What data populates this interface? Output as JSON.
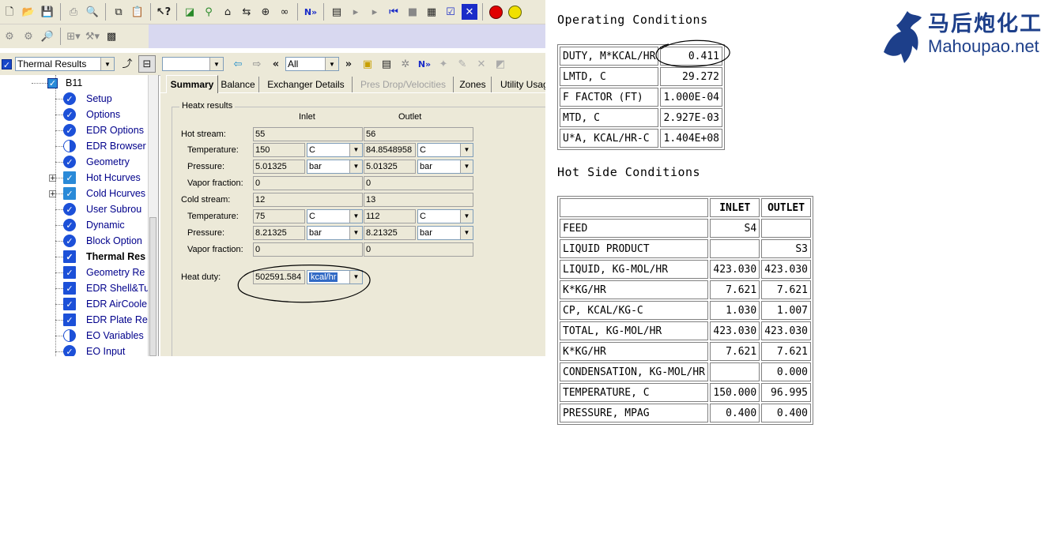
{
  "toolbar3": {
    "results_combo": "Thermal Results",
    "nav_combo": "All",
    "blank_combo": ""
  },
  "tree": {
    "root": "B11",
    "items": [
      {
        "label": "Setup",
        "icon": "check-circle-icon"
      },
      {
        "label": "Options",
        "icon": "check-circle-icon"
      },
      {
        "label": "EDR Options",
        "icon": "check-circle-icon"
      },
      {
        "label": "EDR Browser",
        "icon": "half-circle-icon"
      },
      {
        "label": "Geometry",
        "icon": "check-circle-icon"
      },
      {
        "label": "Hot Hcurves",
        "icon": "check-folder-icon"
      },
      {
        "label": "Cold Hcurves",
        "icon": "check-folder-icon"
      },
      {
        "label": "User Subrou",
        "icon": "check-circle-icon"
      },
      {
        "label": "Dynamic",
        "icon": "check-circle-icon"
      },
      {
        "label": "Block Option",
        "icon": "check-circle-icon"
      },
      {
        "label": "Thermal Res",
        "icon": "check-box-icon"
      },
      {
        "label": "Geometry Re",
        "icon": "check-box-icon"
      },
      {
        "label": "EDR Shell&Tu",
        "icon": "check-box-icon"
      },
      {
        "label": "EDR AirCoole",
        "icon": "check-box-icon"
      },
      {
        "label": "EDR Plate Re",
        "icon": "check-box-icon"
      },
      {
        "label": "EO Variables",
        "icon": "half-circle-icon"
      },
      {
        "label": "EO Input",
        "icon": "check-circle-icon"
      }
    ]
  },
  "tabs": [
    "Summary",
    "Balance",
    "Exchanger Details",
    "Pres Drop/Velocities",
    "Zones",
    "Utility Usage"
  ],
  "heatx": {
    "group_title": "Heatx results",
    "inlet_label": "Inlet",
    "outlet_label": "Outlet",
    "hot_stream_label": "Hot stream:",
    "hot_stream_inlet": "55",
    "hot_stream_outlet": "56",
    "temperature_label": "Temperature:",
    "hot_temp_inlet": "150",
    "hot_temp_inlet_unit": "C",
    "hot_temp_outlet": "84.8548958",
    "hot_temp_outlet_unit": "C",
    "pressure_label": "Pressure:",
    "hot_pres_inlet": "5.01325",
    "hot_pres_inlet_unit": "bar",
    "hot_pres_outlet": "5.01325",
    "hot_pres_outlet_unit": "bar",
    "vapor_label": "Vapor fraction:",
    "hot_vap_inlet": "0",
    "hot_vap_outlet": "0",
    "cold_stream_label": "Cold stream:",
    "cold_stream_inlet": "12",
    "cold_stream_outlet": "13",
    "cold_temp_inlet": "75",
    "cold_temp_inlet_unit": "C",
    "cold_temp_outlet": "112",
    "cold_temp_outlet_unit": "C",
    "cold_pres_inlet": "8.21325",
    "cold_pres_inlet_unit": "bar",
    "cold_pres_outlet": "8.21325",
    "cold_pres_outlet_unit": "bar",
    "cold_vap_inlet": "0",
    "cold_vap_outlet": "0",
    "heat_duty_label": "Heat duty:",
    "heat_duty_value": "502591.584",
    "heat_duty_unit": "kcal/hr"
  },
  "report": {
    "operating_title": "Operating Conditions",
    "operating_rows": [
      {
        "label": "DUTY, M*KCAL/HR",
        "value": "0.411"
      },
      {
        "label": "LMTD, C",
        "value": "29.272"
      },
      {
        "label": "F FACTOR (FT)",
        "value": "1.000E-04"
      },
      {
        "label": "MTD, C",
        "value": "2.927E-03"
      },
      {
        "label": "U*A, KCAL/HR-C",
        "value": "1.404E+08"
      }
    ],
    "hot_side_title": "Hot Side Conditions",
    "hot_side_headers": [
      "",
      "INLET",
      "OUTLET"
    ],
    "hot_side_rows": [
      {
        "label": "FEED",
        "inlet": "S4",
        "outlet": ""
      },
      {
        "label": "LIQUID PRODUCT",
        "inlet": "",
        "outlet": "S3"
      },
      {
        "label": "LIQUID, KG-MOL/HR",
        "inlet": "423.030",
        "outlet": "423.030"
      },
      {
        "label": "K*KG/HR",
        "inlet": "7.621",
        "outlet": "7.621"
      },
      {
        "label": "CP, KCAL/KG-C",
        "inlet": "1.030",
        "outlet": "1.007"
      },
      {
        "label": "TOTAL, KG-MOL/HR",
        "inlet": "423.030",
        "outlet": "423.030"
      },
      {
        "label": "K*KG/HR",
        "inlet": "7.621",
        "outlet": "7.621"
      },
      {
        "label": "CONDENSATION, KG-MOL/HR",
        "inlet": "",
        "outlet": "0.000"
      },
      {
        "label": "TEMPERATURE, C",
        "inlet": "150.000",
        "outlet": "96.995"
      },
      {
        "label": "PRESSURE, MPAG",
        "inlet": "0.400",
        "outlet": "0.400"
      }
    ]
  },
  "logo": {
    "chinese": "马后炮化工",
    "english": "Mahoupao.net",
    "color": "#1d3f8a"
  }
}
